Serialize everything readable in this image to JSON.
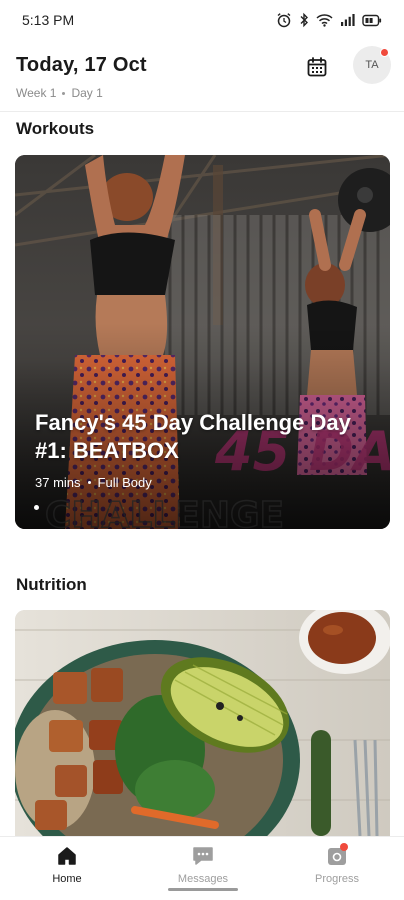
{
  "status_bar": {
    "time": "5:13 PM",
    "icons": [
      "alarm-icon",
      "bluetooth-icon",
      "wifi-icon",
      "signal-icon",
      "battery-icon"
    ]
  },
  "header": {
    "title": "Today, 17 Oct",
    "week": "Week 1",
    "day": "Day 1",
    "avatar_initials": "TA",
    "calendar_icon": "calendar-icon",
    "notification_badge_color": "#f04a3c"
  },
  "workouts": {
    "section_title": "Workouts",
    "card": {
      "title": "Fancy's 45 Day Challenge Day #1: BEATBOX",
      "duration": "37 mins",
      "category": "Full Body"
    }
  },
  "nutrition": {
    "section_title": "Nutrition"
  },
  "bottom_nav": {
    "items": [
      {
        "label": "Home",
        "icon": "home-icon",
        "active": true
      },
      {
        "label": "Messages",
        "icon": "chat-icon",
        "active": false
      },
      {
        "label": "Progress",
        "icon": "progress-icon",
        "active": false
      }
    ]
  },
  "colors": {
    "accent_badge": "#f04a3c",
    "nav_active": "#1a1a1a",
    "nav_inactive": "#9e9e9e"
  }
}
